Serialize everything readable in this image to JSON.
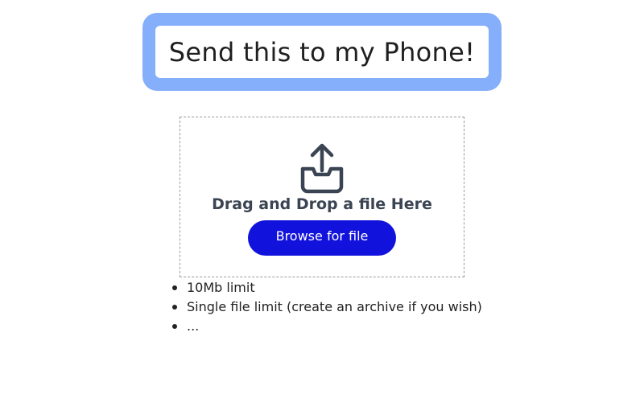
{
  "header": {
    "title": "Send this to my Phone!"
  },
  "upload": {
    "icon": "upload-tray-icon",
    "drop_label": "Drag and Drop a file Here",
    "browse_label": "Browse for file"
  },
  "notes": [
    "10Mb limit",
    "Single file limit (create an archive if you wish)",
    "..."
  ],
  "colors": {
    "title_frame": "#85aefb",
    "button": "#1212dd",
    "icon": "#3a4452"
  }
}
